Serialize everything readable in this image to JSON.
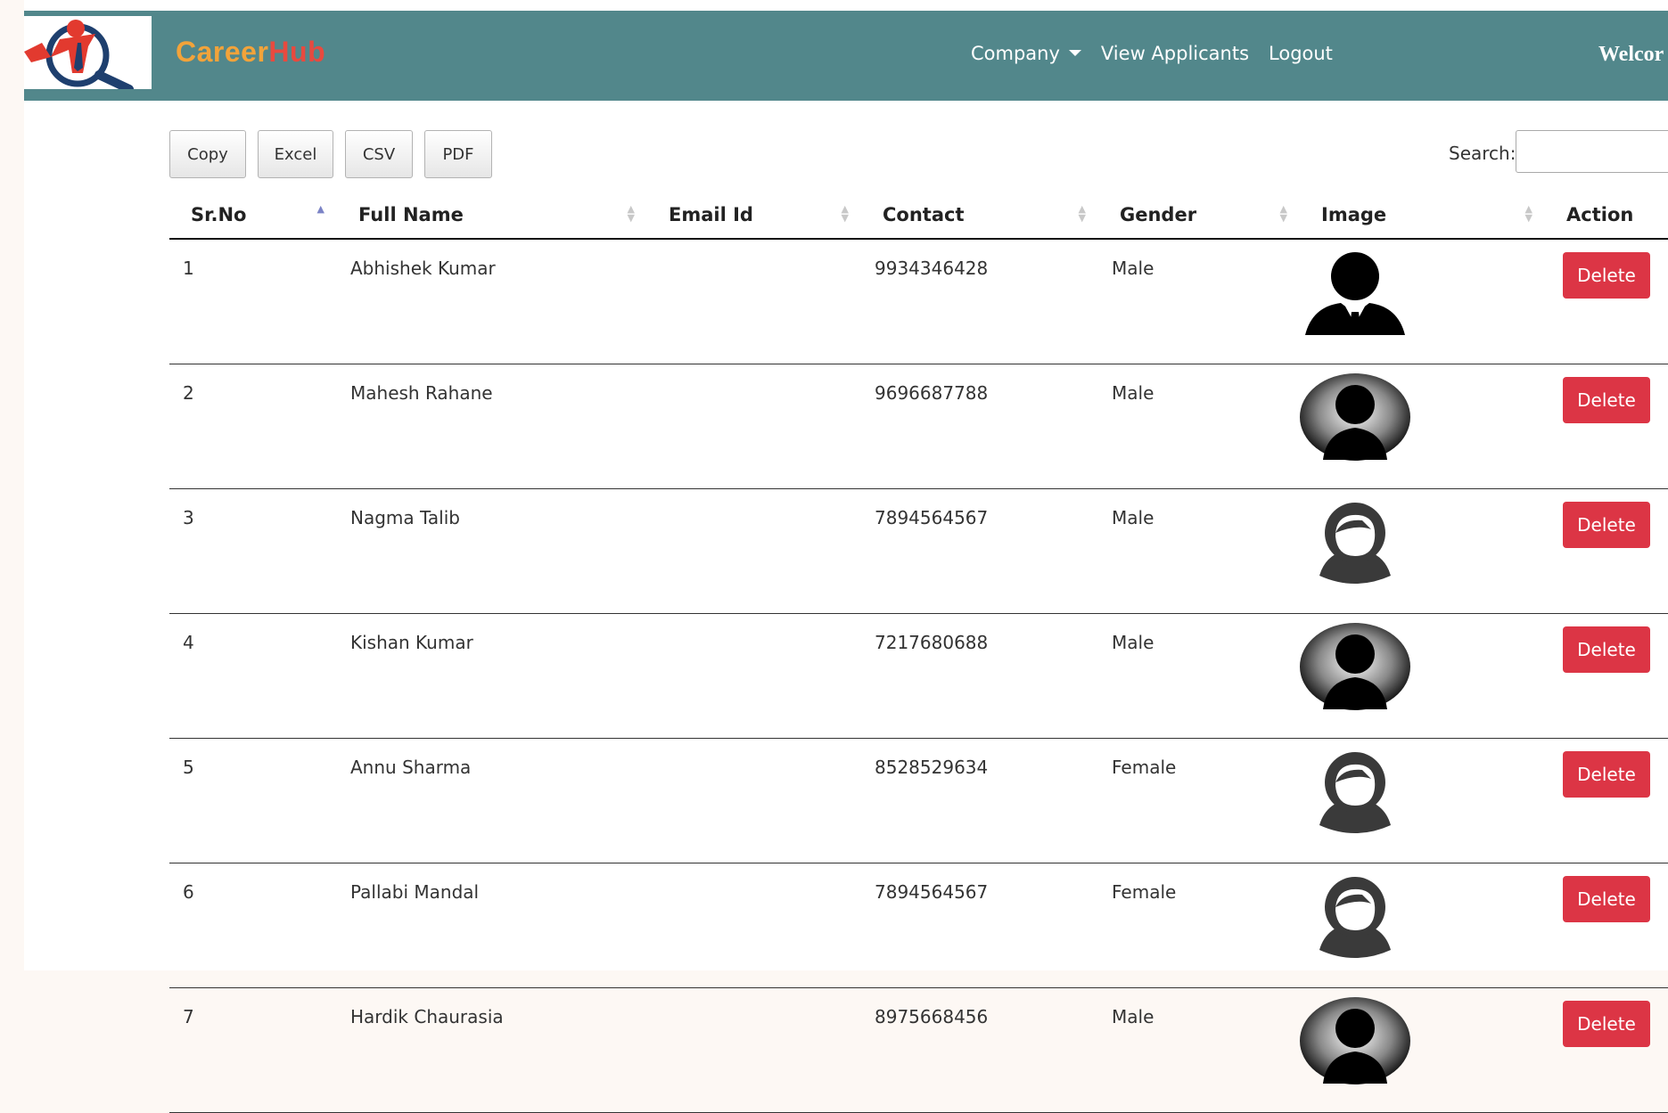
{
  "nav": {
    "brand_part1": "Career",
    "brand_part2": "Hub",
    "company_label": "Company",
    "view_applicants_label": "View Applicants",
    "logout_label": "Logout",
    "welcome_text": "Welcor"
  },
  "toolbar": {
    "copy_label": "Copy",
    "excel_label": "Excel",
    "csv_label": "CSV",
    "pdf_label": "PDF"
  },
  "search": {
    "label": "Search:",
    "value": ""
  },
  "table": {
    "headers": [
      "Sr.No",
      "Full Name",
      "Email Id",
      "Contact",
      "Gender",
      "Image",
      "Action"
    ],
    "rows": [
      {
        "srno": "1",
        "name": "Abhishek Kumar",
        "email": "",
        "contact": "9934346428",
        "gender": "Male",
        "image": "male-suit-avatar",
        "action": "Delete"
      },
      {
        "srno": "2",
        "name": "Mahesh Rahane",
        "email": "",
        "contact": "9696687788",
        "gender": "Male",
        "image": "male-silhouette-avatar",
        "action": "Delete"
      },
      {
        "srno": "3",
        "name": "Nagma Talib",
        "email": "",
        "contact": "7894564567",
        "gender": "Male",
        "image": "female-outline-avatar",
        "action": "Delete"
      },
      {
        "srno": "4",
        "name": "Kishan Kumar",
        "email": "",
        "contact": "7217680688",
        "gender": "Male",
        "image": "male-silhouette-avatar",
        "action": "Delete"
      },
      {
        "srno": "5",
        "name": "Annu Sharma",
        "email": "",
        "contact": "8528529634",
        "gender": "Female",
        "image": "female-outline-avatar",
        "action": "Delete"
      },
      {
        "srno": "6",
        "name": "Pallabi Mandal",
        "email": "",
        "contact": "7894564567",
        "gender": "Female",
        "image": "female-outline-avatar",
        "action": "Delete"
      },
      {
        "srno": "7",
        "name": "Hardik Chaurasia",
        "email": "",
        "contact": "8975668456",
        "gender": "Male",
        "image": "male-silhouette-avatar",
        "action": "Delete"
      }
    ]
  },
  "colors": {
    "navbar": "#52878b",
    "brand_orange": "#f2a33a",
    "brand_red": "#e84a3f",
    "delete": "#dc3545"
  }
}
